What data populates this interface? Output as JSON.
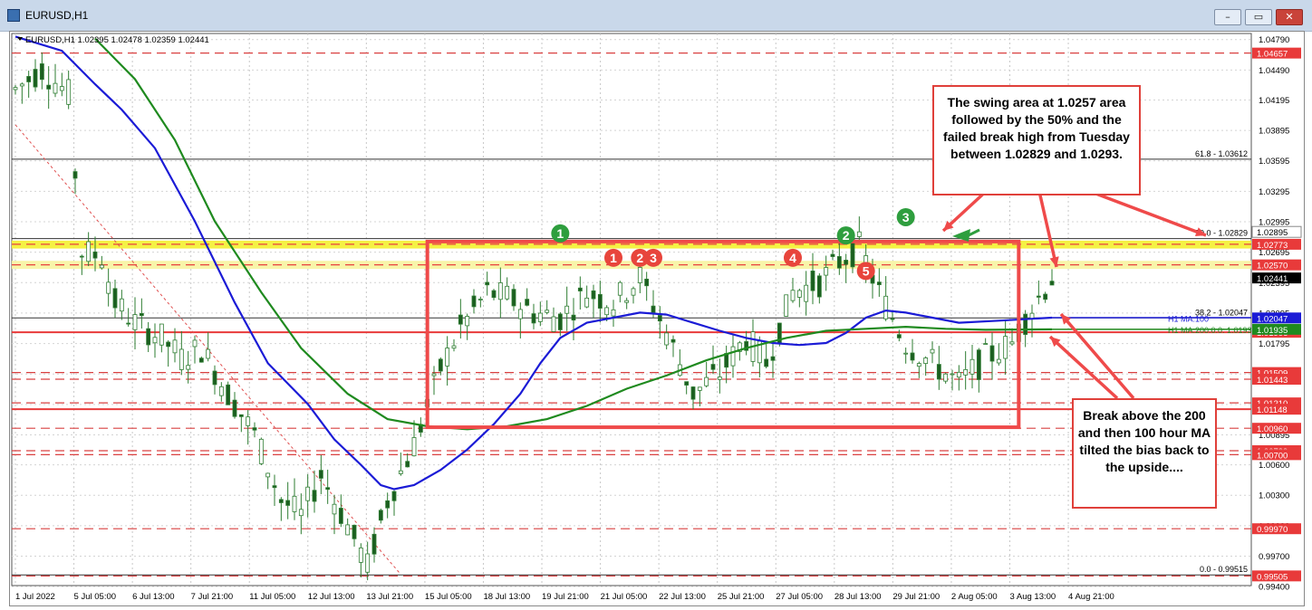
{
  "window": {
    "title": "EURUSD,H1",
    "min_label": "–",
    "restore_label": "▭",
    "close_label": "✕"
  },
  "chart_data": {
    "type": "candlestick",
    "symbol_header": "EURUSD,H1  1.02395 1.02478 1.02359 1.02441",
    "ylim": [
      0.9941,
      1.0485
    ],
    "y_ticks": [
      1.0479,
      1.0449,
      1.04195,
      1.03895,
      1.03595,
      1.03295,
      1.02995,
      1.02695,
      1.02395,
      1.02095,
      1.01795,
      1.01495,
      1.01195,
      1.00895,
      1.006,
      1.003,
      1.0,
      0.997,
      0.994
    ],
    "x_labels": [
      "1 Jul 2022",
      "5 Jul 05:00",
      "6 Jul 13:00",
      "7 Jul 21:00",
      "11 Jul 05:00",
      "12 Jul 13:00",
      "13 Jul 21:00",
      "15 Jul 05:00",
      "18 Jul 13:00",
      "19 Jul 21:00",
      "21 Jul 05:00",
      "22 Jul 13:00",
      "25 Jul 21:00",
      "27 Jul 05:00",
      "28 Jul 13:00",
      "29 Jul 21:00",
      "2 Aug 05:00",
      "3 Aug 13:00",
      "4 Aug 21:00"
    ],
    "level_lines": [
      {
        "price": 1.04657,
        "label": "1.04657",
        "style": "dashed",
        "color": "#d94040"
      },
      {
        "price": 1.02773,
        "label": "1.02773",
        "style": "band",
        "color": "#f2ef3a"
      },
      {
        "price": 1.0257,
        "label": "1.02570",
        "style": "band",
        "color": "#f2ef3a"
      },
      {
        "price": 1.01906,
        "label": "1.01906",
        "style": "solid",
        "color": "#e83a3a"
      },
      {
        "price": 1.01509,
        "label": "1.01509",
        "style": "dashed",
        "color": "#d94040"
      },
      {
        "price": 1.01443,
        "label": "1.01443",
        "style": "dashed",
        "color": "#d94040"
      },
      {
        "price": 1.0121,
        "label": "1.01210",
        "style": "dashed",
        "color": "#d94040"
      },
      {
        "price": 1.01148,
        "label": "1.01148",
        "style": "solid",
        "color": "#e83a3a"
      },
      {
        "price": 1.0096,
        "label": "1.00960",
        "style": "dashed",
        "color": "#d94040"
      },
      {
        "price": 1.00739,
        "label": "1.00739",
        "style": "dashed",
        "color": "#d94040"
      },
      {
        "price": 1.007,
        "label": "1.00700",
        "style": "dashed",
        "color": "#d94040"
      },
      {
        "price": 0.9997,
        "label": "0.99970",
        "style": "dashed",
        "color": "#d94040"
      },
      {
        "price": 0.99505,
        "label": "0.99505",
        "style": "dashed",
        "color": "#d94040"
      }
    ],
    "fib_levels": [
      {
        "price": 1.03612,
        "label": "61.8 - 1.03612"
      },
      {
        "price": 1.02829,
        "label": "50.0 - 1.02829"
      },
      {
        "price": 1.02047,
        "label": "38.2 - 1.02047"
      },
      {
        "price": 0.99515,
        "label": "0.0 - 0.99515"
      }
    ],
    "price_tags": [
      {
        "price": 1.02895,
        "label": "1.02895"
      },
      {
        "price": 1.02441,
        "label": "1.02441"
      },
      {
        "price": 1.02047,
        "label": "1.02047"
      },
      {
        "price": 1.01935,
        "label": "1.01935"
      }
    ],
    "ma_labels": [
      {
        "text": "H1 MA:100",
        "color": "#1b1bd6"
      },
      {
        "text": "H1 MA:200:0:0: 1.01935",
        "color": "#1f8a1f"
      }
    ],
    "series": [
      {
        "name": "H1 MA:100",
        "color": "#1b1bd6",
        "points": [
          [
            0,
            1.0482
          ],
          [
            7,
            1.0468
          ],
          [
            12,
            1.0435
          ],
          [
            16,
            1.041
          ],
          [
            21,
            1.0372
          ],
          [
            27,
            1.03
          ],
          [
            33,
            1.022
          ],
          [
            38,
            1.016
          ],
          [
            44,
            1.012
          ],
          [
            48,
            1.0085
          ],
          [
            52,
            1.006
          ],
          [
            55,
            1.004
          ],
          [
            57,
            1.0036
          ],
          [
            60,
            1.004
          ],
          [
            64,
            1.0055
          ],
          [
            68,
            1.0075
          ],
          [
            72,
            1.01
          ],
          [
            76,
            1.013
          ],
          [
            79,
            1.016
          ],
          [
            82,
            1.0185
          ],
          [
            86,
            1.02
          ],
          [
            90,
            1.0205
          ],
          [
            94,
            1.021
          ],
          [
            98,
            1.0208
          ],
          [
            102,
            1.02
          ],
          [
            106,
            1.0192
          ],
          [
            110,
            1.0185
          ],
          [
            114,
            1.018
          ],
          [
            118,
            1.0178
          ],
          [
            122,
            1.018
          ],
          [
            125,
            1.019
          ],
          [
            128,
            1.0205
          ],
          [
            131,
            1.0212
          ],
          [
            134,
            1.021
          ],
          [
            138,
            1.0205
          ],
          [
            142,
            1.02
          ],
          [
            148,
            1.0202
          ],
          [
            156,
            1.0205
          ]
        ]
      },
      {
        "name": "H1 MA:200",
        "color": "#1f8a1f",
        "points": [
          [
            12,
            1.048
          ],
          [
            18,
            1.044
          ],
          [
            24,
            1.038
          ],
          [
            30,
            1.03
          ],
          [
            37,
            1.023
          ],
          [
            43,
            1.0175
          ],
          [
            50,
            1.013
          ],
          [
            56,
            1.0105
          ],
          [
            62,
            1.0098
          ],
          [
            68,
            1.0095
          ],
          [
            74,
            1.0098
          ],
          [
            80,
            1.0105
          ],
          [
            86,
            1.0118
          ],
          [
            92,
            1.0135
          ],
          [
            98,
            1.0148
          ],
          [
            104,
            1.0163
          ],
          [
            110,
            1.0175
          ],
          [
            116,
            1.0185
          ],
          [
            122,
            1.0192
          ],
          [
            128,
            1.0194
          ],
          [
            134,
            1.0196
          ],
          [
            140,
            1.0194
          ],
          [
            146,
            1.0193
          ],
          [
            156,
            1.01935
          ]
        ]
      }
    ],
    "markers": [
      {
        "text": "1",
        "color": "#2e9e3e",
        "bar": 82,
        "price": 1.0288
      },
      {
        "text": "1",
        "color": "#e8453c",
        "bar": 90,
        "price": 1.0264
      },
      {
        "text": "2",
        "color": "#e8453c",
        "bar": 94,
        "price": 1.0264
      },
      {
        "text": "3",
        "color": "#e8453c",
        "bar": 96,
        "price": 1.0264
      },
      {
        "text": "4",
        "color": "#e8453c",
        "bar": 117,
        "price": 1.0264
      },
      {
        "text": "2",
        "color": "#2e9e3e",
        "bar": 125,
        "price": 1.0286
      },
      {
        "text": "3",
        "color": "#2e9e3e",
        "bar": 134,
        "price": 1.0304
      },
      {
        "text": "5",
        "color": "#e8453c",
        "bar": 128,
        "price": 1.0251
      }
    ],
    "annotations": [
      {
        "text": "The swing area at 1.0257 area followed by the 50% and the failed break high from Tuesday between 1.02829 and 1.0293."
      },
      {
        "text": "Break above the 200 and then 100 hour MA tilted the bias back to the upside...."
      }
    ]
  }
}
